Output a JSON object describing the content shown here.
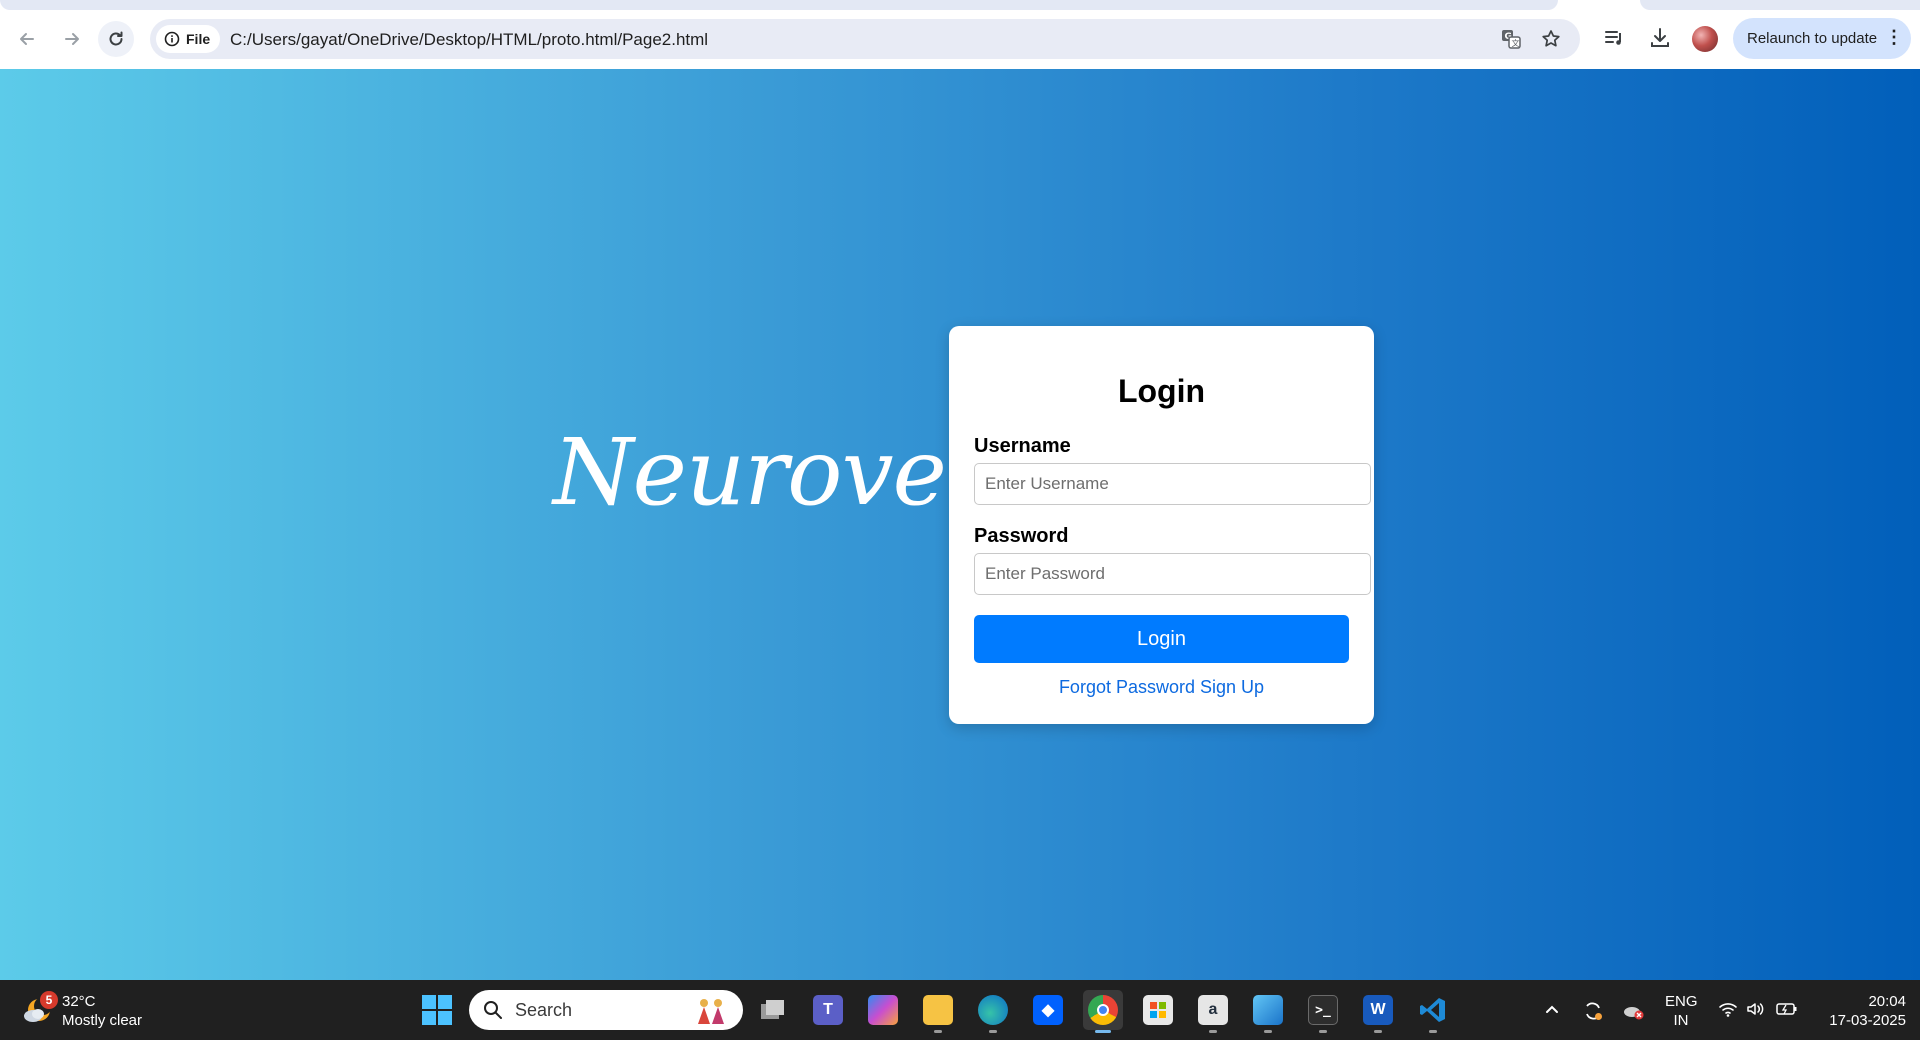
{
  "browser": {
    "site_chip_label": "File",
    "url": "C:/Users/gayat/OneDrive/Desktop/HTML/proto.html/Page2.html",
    "relaunch_label": "Relaunch to update",
    "menu_glyph": "⋮"
  },
  "page": {
    "brand": "Neuroverse",
    "login": {
      "title": "Login",
      "username_label": "Username",
      "username_placeholder": "Enter Username",
      "password_label": "Password",
      "password_placeholder": "Enter Password",
      "submit_label": "Login",
      "forgot_link": "Forgot Password",
      "signup_link": "Sign Up"
    },
    "colors": {
      "gradient_start": "#5ccbe9",
      "gradient_end": "#015fba",
      "button": "#007bff",
      "link": "#0d6ae0"
    }
  },
  "taskbar": {
    "weather": {
      "badge": "5",
      "temp": "32°C",
      "condition": "Mostly clear"
    },
    "search_placeholder": "Search",
    "apps": [
      "task-view",
      "teams",
      "copilot",
      "file-explorer",
      "edge",
      "dropbox",
      "chrome",
      "microsoft-store",
      "amazon",
      "photos",
      "terminal",
      "word",
      "vs-code"
    ],
    "language": {
      "line1": "ENG",
      "line2": "IN"
    },
    "clock": {
      "time": "20:04",
      "date": "17-03-2025"
    }
  }
}
